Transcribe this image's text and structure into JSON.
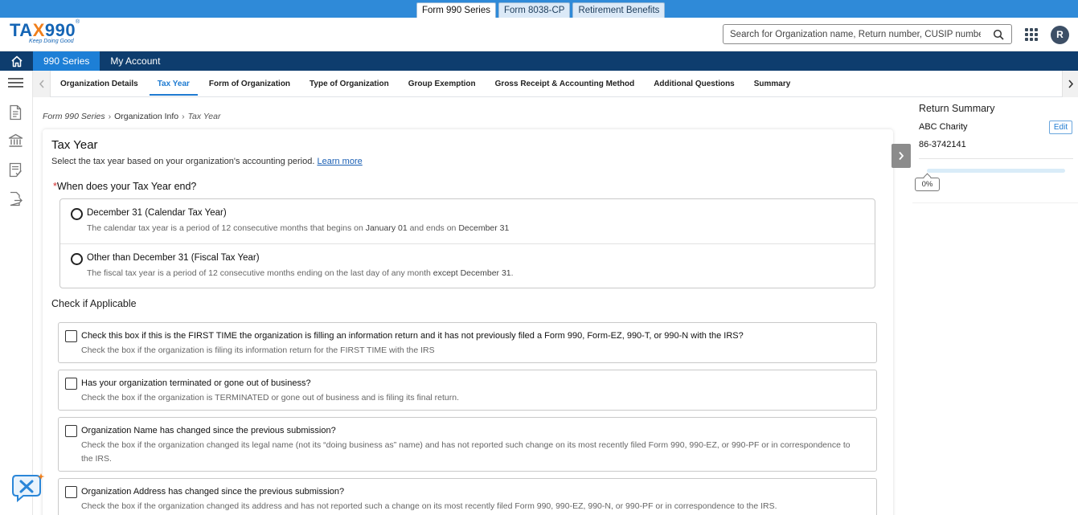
{
  "product_tabs": [
    "Form 990 Series",
    "Form 8038-CP",
    "Retirement Benefits"
  ],
  "logo": {
    "text_a": "TA",
    "text_x": "X",
    "text_b": "990",
    "tagline": "Keep Doing Good",
    "reg": "®"
  },
  "search": {
    "placeholder": "Search for Organization name, Return number, CUSIP number"
  },
  "user": {
    "avatar_initial": "R"
  },
  "main_nav": {
    "items": [
      "990 Series",
      "My Account"
    ]
  },
  "sub_nav": {
    "tabs": [
      "Organization Details",
      "Tax Year",
      "Form of Organization",
      "Type of Organization",
      "Group Exemption",
      "Gross Receipt & Accounting Method",
      "Additional Questions",
      "Summary"
    ],
    "active": "Tax Year"
  },
  "breadcrumb": {
    "root": "Form 990 Series",
    "parent": "Organization Info",
    "current": "Tax Year"
  },
  "page": {
    "title": "Tax Year",
    "subtitle": "Select the tax year based on your organization's accounting period.",
    "learn_more": "Learn more",
    "question_required_mark": "*",
    "question": "When does your Tax Year end?",
    "options": [
      {
        "title": "December 31 (Calendar Tax Year)",
        "desc_a": "The calendar tax year is a period of 12 consecutive months that begins on ",
        "desc_b": "January 01",
        "desc_c": " and ends on ",
        "desc_d": "December 31"
      },
      {
        "title": "Other than December 31 (Fiscal Tax Year)",
        "desc_a": "The fiscal tax year is a period of 12 consecutive months ending on the last day of any month ",
        "desc_b": "except December 31",
        "desc_c": "."
      }
    ],
    "check_heading": "Check if Applicable",
    "checks": [
      {
        "title": "Check this box if this is the FIRST TIME the organization is filling an information return and it has not previously filed a Form 990, Form-EZ, 990-T, or 990-N with the IRS?",
        "desc": "Check the box if the organization is filing its information return for the FIRST TIME with the IRS"
      },
      {
        "title": "Has your organization terminated or gone out of business?",
        "desc": "Check the box if the organization is TERMINATED or gone out of business and is filing its final return."
      },
      {
        "title": "Organization Name has changed since the previous submission?",
        "desc": "Check the box if the organization changed its legal name (not its “doing business as” name) and has not reported such change on its most recently filed Form 990, 990-EZ, or 990-PF or in correspondence to the IRS."
      },
      {
        "title": "Organization Address has changed since the previous submission?",
        "desc": "Check the box if the organization changed its address and has not reported such a change on its most recently filed Form 990, 990-EZ, 990-N, or 990-PF or in correspondence to the IRS."
      }
    ]
  },
  "return_summary": {
    "title": "Return Summary",
    "org_name": "ABC Charity",
    "ein": "86-3742141",
    "edit_label": "Edit",
    "progress_label": "0%",
    "progress_value": 0
  },
  "colors": {
    "primary": "#1f7bd1",
    "nav_bg": "#0e3d6e",
    "brand_orange": "#f07f1b",
    "required": "#d32f2f"
  }
}
